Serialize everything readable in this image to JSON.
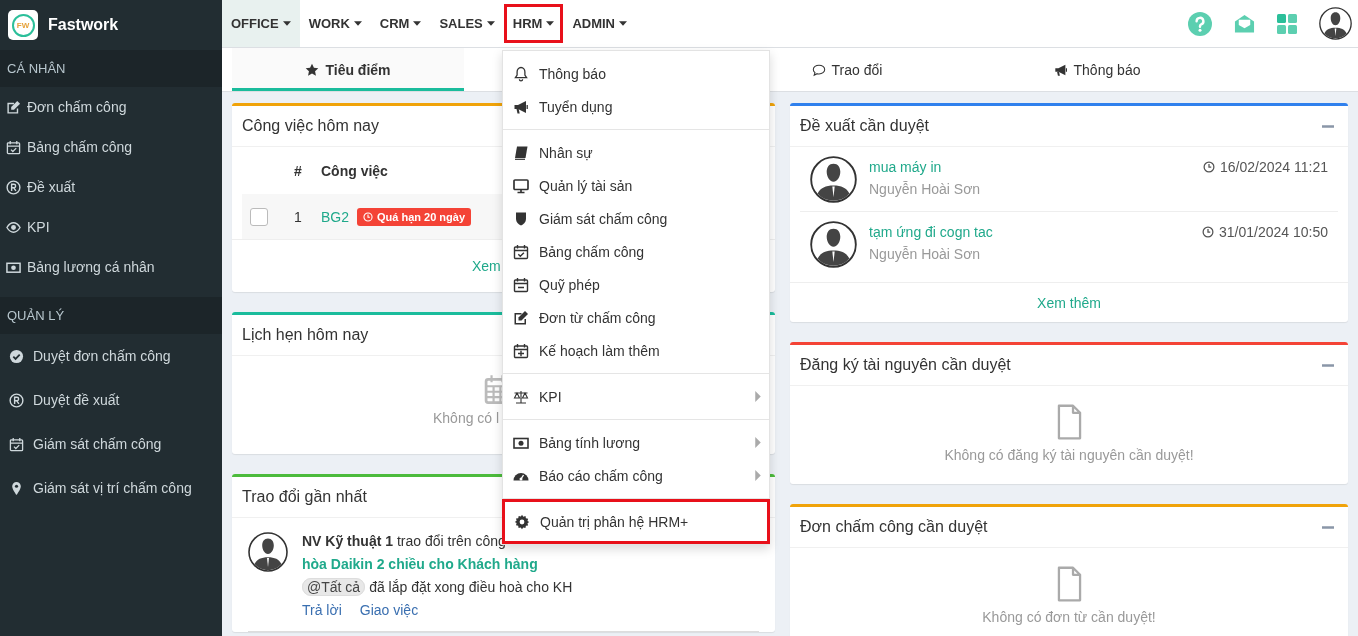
{
  "app": {
    "logo_text": "FW",
    "name": "Fastwork"
  },
  "sidebar": {
    "sections": [
      {
        "title": "CÁ NHÂN",
        "items": [
          "Đơn chấm công",
          "Bảng chấm công",
          "Đề xuất",
          "KPI",
          "Bảng lương cá nhân"
        ]
      },
      {
        "title": "QUẢN LÝ",
        "items": [
          "Duyệt đơn chấm công",
          "Duyệt đề xuất",
          "Giám sát chấm công",
          "Giám sát vị trí chấm công"
        ]
      }
    ]
  },
  "topnav": {
    "items": [
      {
        "label": "OFFICE",
        "selected": true,
        "highlighted": false
      },
      {
        "label": "WORK",
        "selected": false,
        "highlighted": false
      },
      {
        "label": "CRM",
        "selected": false,
        "highlighted": false
      },
      {
        "label": "SALES",
        "selected": false,
        "highlighted": false
      },
      {
        "label": "HRM",
        "selected": false,
        "highlighted": true
      },
      {
        "label": "ADMIN",
        "selected": false,
        "highlighted": false
      }
    ]
  },
  "tabs": [
    {
      "label": "Tiêu điểm",
      "selected": true
    },
    {
      "label": "Trao đổi",
      "selected": false
    },
    {
      "label": "Thông báo",
      "selected": false
    }
  ],
  "hrm_menu": {
    "groups": [
      [
        {
          "label": "Thông báo",
          "has_submenu": false,
          "highlighted": false
        },
        {
          "label": "Tuyển dụng",
          "has_submenu": false,
          "highlighted": false
        }
      ],
      [
        {
          "label": "Nhân sự",
          "has_submenu": false,
          "highlighted": false
        },
        {
          "label": "Quản lý tài sản",
          "has_submenu": false,
          "highlighted": false
        },
        {
          "label": "Giám sát chấm công",
          "has_submenu": false,
          "highlighted": false
        },
        {
          "label": "Bảng chấm công",
          "has_submenu": false,
          "highlighted": false
        },
        {
          "label": "Quỹ phép",
          "has_submenu": false,
          "highlighted": false
        },
        {
          "label": "Đơn từ chấm công",
          "has_submenu": false,
          "highlighted": false
        },
        {
          "label": "Kế hoạch làm thêm",
          "has_submenu": false,
          "highlighted": false
        }
      ],
      [
        {
          "label": "KPI",
          "has_submenu": true,
          "highlighted": false
        }
      ],
      [
        {
          "label": "Bảng tính lương",
          "has_submenu": true,
          "highlighted": false
        },
        {
          "label": "Báo cáo chấm công",
          "has_submenu": true,
          "highlighted": false
        }
      ],
      [
        {
          "label": "Quản trị phân hệ HRM+",
          "has_submenu": false,
          "highlighted": true
        }
      ]
    ]
  },
  "cards_left": [
    {
      "kind": "tasks",
      "title": "Công việc hôm nay",
      "color": "#f0a30a",
      "columns": [
        "#",
        "Công việc"
      ],
      "rows": [
        {
          "checked": false,
          "number": "1",
          "name": "BG2",
          "badge": "Quá hạn 20 ngày"
        }
      ],
      "more": "Xem"
    },
    {
      "kind": "schedule",
      "title": "Lịch hẹn hôm nay",
      "color": "#1abc9c",
      "message": "Không có l"
    },
    {
      "kind": "discussion",
      "title": "Trao đổi gần nhất",
      "color": "#4cbb3c",
      "posts": [
        {
          "intro": "**NV Kỹ thuật 1** trao đổi trên công",
          "link": "hòa Daikin 2 chiều cho Khách hàng",
          "mention": "@Tất cả",
          "message": "đã lắp đặt xong điều hoà cho KH",
          "actions": [
            "Trả lời",
            "Giao việc"
          ]
        }
      ]
    }
  ],
  "cards_right": [
    {
      "kind": "proposals",
      "title": "Đề xuất cần duyệt",
      "color": "#2f80ed",
      "collapsible": true,
      "items": [
        {
          "title": "mua máy in",
          "author": "Nguyễn Hoài Sơn",
          "time": "16/02/2024 11:21"
        },
        {
          "title": "tạm ứng đi cogn tac",
          "author": "Nguyễn Hoài Sơn",
          "time": "31/01/2024 10:50"
        }
      ],
      "more": "Xem thêm"
    },
    {
      "kind": "empty",
      "title": "Đăng ký tài nguyên cần duyệt",
      "color": "#f44336",
      "collapsible": true,
      "message": "Không có đăng ký tài nguyên cần duyệt!"
    },
    {
      "kind": "empty",
      "title": "Đơn chấm công cần duyệt",
      "color": "#f0a30a",
      "collapsible": true,
      "message": "Không có đơn từ cần duyệt!"
    }
  ]
}
